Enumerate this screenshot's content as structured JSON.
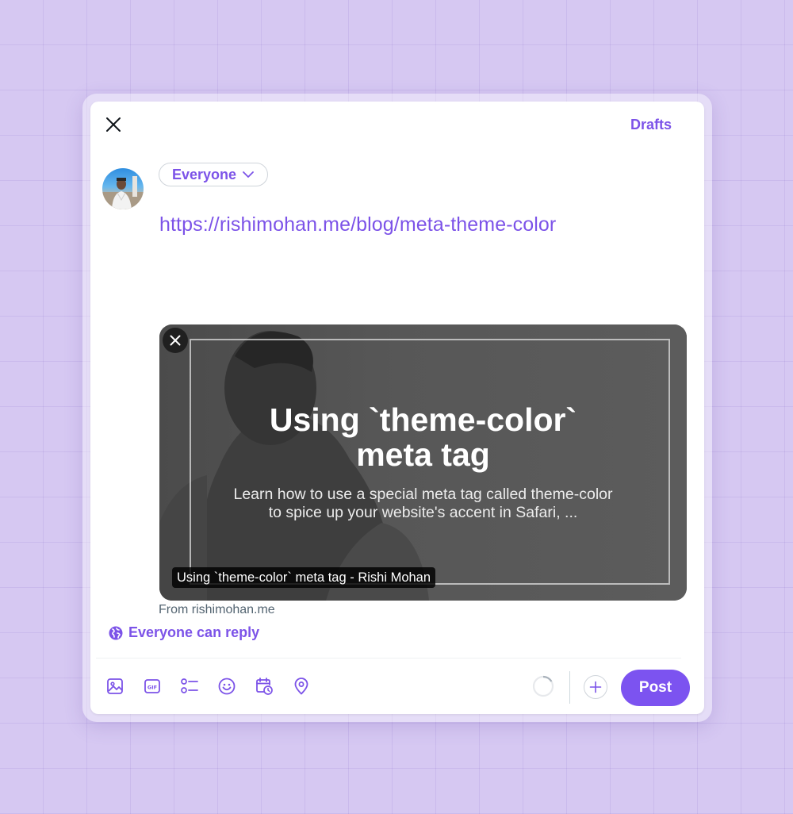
{
  "header": {
    "drafts_label": "Drafts"
  },
  "compose": {
    "audience_label": "Everyone",
    "text": "https://rishimohan.me/blog/meta-theme-color"
  },
  "link_card": {
    "title_line1": "Using `theme-color`",
    "title_line2": "meta tag",
    "description_line1": "Learn how to use a special meta tag called theme-color",
    "description_line2": "to spice up your website's accent in Safari, ...",
    "label": "Using `theme-color` meta tag - Rishi Mohan",
    "source": "From rishimohan.me"
  },
  "reply_setting": {
    "label": "Everyone can reply"
  },
  "toolbar": {
    "icons": [
      "image-icon",
      "gif-icon",
      "poll-icon",
      "emoji-icon",
      "schedule-icon",
      "location-icon"
    ],
    "post_label": "Post"
  },
  "colors": {
    "accent": "#7c53e8",
    "post_button": "#7c53f0",
    "background": "#d6c8f2"
  }
}
